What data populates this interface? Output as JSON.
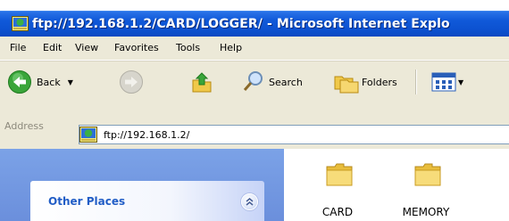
{
  "window": {
    "title": "ftp://192.168.1.2/CARD/LOGGER/ - Microsoft Internet Explo"
  },
  "menu": {
    "items": [
      "File",
      "Edit",
      "View",
      "Favorites",
      "Tools",
      "Help"
    ]
  },
  "toolbar": {
    "back_label": "Back",
    "search_label": "Search",
    "folders_label": "Folders"
  },
  "address": {
    "label": "Address",
    "value": "ftp://192.168.1.2/"
  },
  "sidebar": {
    "other_places_title": "Other Places"
  },
  "files": [
    {
      "name": "CARD",
      "icon": "folder-icon"
    },
    {
      "name": "MEMORY",
      "icon": "folder-icon"
    }
  ],
  "colors": {
    "titlebar": "#0c52d1",
    "chrome": "#ece9d8",
    "sidebar": "#7ba2e7",
    "sidebar_title": "#215dc6",
    "folder": "#f5d66b"
  }
}
